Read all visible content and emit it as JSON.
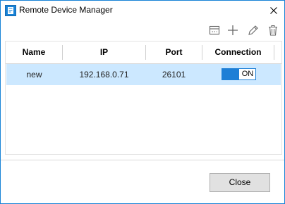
{
  "window": {
    "title": "Remote Device Manager",
    "border_color": "#1883d7"
  },
  "toolbar": {
    "icons": [
      "save-device-icon",
      "plus-icon",
      "pencil-icon",
      "trash-icon"
    ]
  },
  "table": {
    "columns": [
      "Name",
      "IP",
      "Port",
      "Connection"
    ],
    "rows": [
      {
        "name": "new",
        "ip": "192.168.0.71",
        "port": "26101",
        "connection": "ON",
        "selected": true
      }
    ],
    "selected_row_color": "#cce8ff"
  },
  "toggle": {
    "accent": "#1e7fd6"
  },
  "footer": {
    "close_label": "Close"
  }
}
